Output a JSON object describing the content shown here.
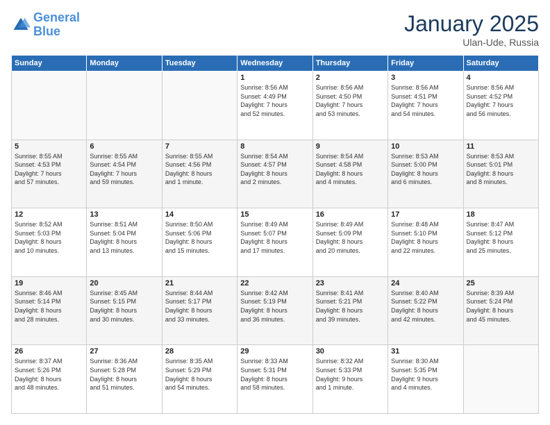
{
  "logo": {
    "line1": "General",
    "line2": "Blue"
  },
  "title": "January 2025",
  "location": "Ulan-Ude, Russia",
  "days_of_week": [
    "Sunday",
    "Monday",
    "Tuesday",
    "Wednesday",
    "Thursday",
    "Friday",
    "Saturday"
  ],
  "weeks": [
    [
      {
        "day": "",
        "info": ""
      },
      {
        "day": "",
        "info": ""
      },
      {
        "day": "",
        "info": ""
      },
      {
        "day": "1",
        "info": "Sunrise: 8:56 AM\nSunset: 4:49 PM\nDaylight: 7 hours\nand 52 minutes."
      },
      {
        "day": "2",
        "info": "Sunrise: 8:56 AM\nSunset: 4:50 PM\nDaylight: 7 hours\nand 53 minutes."
      },
      {
        "day": "3",
        "info": "Sunrise: 8:56 AM\nSunset: 4:51 PM\nDaylight: 7 hours\nand 54 minutes."
      },
      {
        "day": "4",
        "info": "Sunrise: 8:56 AM\nSunset: 4:52 PM\nDaylight: 7 hours\nand 56 minutes."
      }
    ],
    [
      {
        "day": "5",
        "info": "Sunrise: 8:55 AM\nSunset: 4:53 PM\nDaylight: 7 hours\nand 57 minutes."
      },
      {
        "day": "6",
        "info": "Sunrise: 8:55 AM\nSunset: 4:54 PM\nDaylight: 7 hours\nand 59 minutes."
      },
      {
        "day": "7",
        "info": "Sunrise: 8:55 AM\nSunset: 4:56 PM\nDaylight: 8 hours\nand 1 minute."
      },
      {
        "day": "8",
        "info": "Sunrise: 8:54 AM\nSunset: 4:57 PM\nDaylight: 8 hours\nand 2 minutes."
      },
      {
        "day": "9",
        "info": "Sunrise: 8:54 AM\nSunset: 4:58 PM\nDaylight: 8 hours\nand 4 minutes."
      },
      {
        "day": "10",
        "info": "Sunrise: 8:53 AM\nSunset: 5:00 PM\nDaylight: 8 hours\nand 6 minutes."
      },
      {
        "day": "11",
        "info": "Sunrise: 8:53 AM\nSunset: 5:01 PM\nDaylight: 8 hours\nand 8 minutes."
      }
    ],
    [
      {
        "day": "12",
        "info": "Sunrise: 8:52 AM\nSunset: 5:03 PM\nDaylight: 8 hours\nand 10 minutes."
      },
      {
        "day": "13",
        "info": "Sunrise: 8:51 AM\nSunset: 5:04 PM\nDaylight: 8 hours\nand 13 minutes."
      },
      {
        "day": "14",
        "info": "Sunrise: 8:50 AM\nSunset: 5:06 PM\nDaylight: 8 hours\nand 15 minutes."
      },
      {
        "day": "15",
        "info": "Sunrise: 8:49 AM\nSunset: 5:07 PM\nDaylight: 8 hours\nand 17 minutes."
      },
      {
        "day": "16",
        "info": "Sunrise: 8:49 AM\nSunset: 5:09 PM\nDaylight: 8 hours\nand 20 minutes."
      },
      {
        "day": "17",
        "info": "Sunrise: 8:48 AM\nSunset: 5:10 PM\nDaylight: 8 hours\nand 22 minutes."
      },
      {
        "day": "18",
        "info": "Sunrise: 8:47 AM\nSunset: 5:12 PM\nDaylight: 8 hours\nand 25 minutes."
      }
    ],
    [
      {
        "day": "19",
        "info": "Sunrise: 8:46 AM\nSunset: 5:14 PM\nDaylight: 8 hours\nand 28 minutes."
      },
      {
        "day": "20",
        "info": "Sunrise: 8:45 AM\nSunset: 5:15 PM\nDaylight: 8 hours\nand 30 minutes."
      },
      {
        "day": "21",
        "info": "Sunrise: 8:44 AM\nSunset: 5:17 PM\nDaylight: 8 hours\nand 33 minutes."
      },
      {
        "day": "22",
        "info": "Sunrise: 8:42 AM\nSunset: 5:19 PM\nDaylight: 8 hours\nand 36 minutes."
      },
      {
        "day": "23",
        "info": "Sunrise: 8:41 AM\nSunset: 5:21 PM\nDaylight: 8 hours\nand 39 minutes."
      },
      {
        "day": "24",
        "info": "Sunrise: 8:40 AM\nSunset: 5:22 PM\nDaylight: 8 hours\nand 42 minutes."
      },
      {
        "day": "25",
        "info": "Sunrise: 8:39 AM\nSunset: 5:24 PM\nDaylight: 8 hours\nand 45 minutes."
      }
    ],
    [
      {
        "day": "26",
        "info": "Sunrise: 8:37 AM\nSunset: 5:26 PM\nDaylight: 8 hours\nand 48 minutes."
      },
      {
        "day": "27",
        "info": "Sunrise: 8:36 AM\nSunset: 5:28 PM\nDaylight: 8 hours\nand 51 minutes."
      },
      {
        "day": "28",
        "info": "Sunrise: 8:35 AM\nSunset: 5:29 PM\nDaylight: 8 hours\nand 54 minutes."
      },
      {
        "day": "29",
        "info": "Sunrise: 8:33 AM\nSunset: 5:31 PM\nDaylight: 8 hours\nand 58 minutes."
      },
      {
        "day": "30",
        "info": "Sunrise: 8:32 AM\nSunset: 5:33 PM\nDaylight: 9 hours\nand 1 minute."
      },
      {
        "day": "31",
        "info": "Sunrise: 8:30 AM\nSunset: 5:35 PM\nDaylight: 9 hours\nand 4 minutes."
      },
      {
        "day": "",
        "info": ""
      }
    ]
  ]
}
